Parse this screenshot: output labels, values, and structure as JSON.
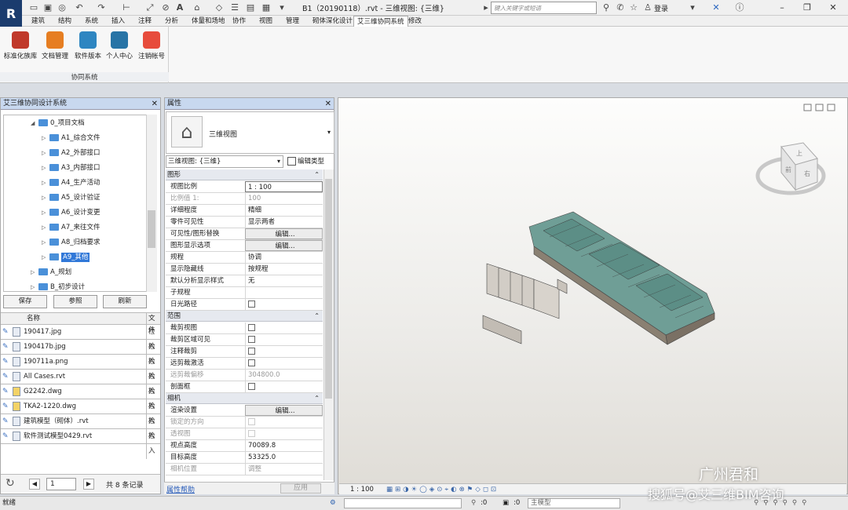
{
  "title_bar": {
    "title": "B1（20190118）.rvt - 三维视图: {三维}",
    "search_placeholder": "键入关键字或短语",
    "login_label": "登录"
  },
  "menu_tabs": [
    "建筑",
    "结构",
    "系统",
    "插入",
    "注释",
    "分析",
    "体量和场地",
    "协作",
    "视图",
    "管理",
    "砌体深化设计",
    "艾三维协同系统",
    "修改"
  ],
  "active_tab": "艾三维协同系统",
  "ribbon": {
    "buttons": [
      {
        "label": "标准化族库",
        "icon": "family-library-icon",
        "color": "#c0392b"
      },
      {
        "label": "文档管理",
        "icon": "document-manager-icon",
        "color": "#e67e22"
      },
      {
        "label": "软件版本",
        "icon": "software-version-icon",
        "color": "#2e86c1"
      },
      {
        "label": "个人中心",
        "icon": "user-icon",
        "color": "#2874a6"
      },
      {
        "label": "注销帐号",
        "icon": "power-icon",
        "color": "#e74c3c"
      }
    ],
    "group_label": "协同系统"
  },
  "left_panel": {
    "title": "艾三维协同设计系统",
    "tree": [
      {
        "label": "0_项目文档",
        "level": 0,
        "expanded": true
      },
      {
        "label": "A1_综合文件",
        "level": 1
      },
      {
        "label": "A2_外部接口",
        "level": 1
      },
      {
        "label": "A3_内部接口",
        "level": 1
      },
      {
        "label": "A4_生产活动",
        "level": 1
      },
      {
        "label": "A5_设计验证",
        "level": 1
      },
      {
        "label": "A6_设计变更",
        "level": 1
      },
      {
        "label": "A7_来往文件",
        "level": 1
      },
      {
        "label": "A8_归档要求",
        "level": 1
      },
      {
        "label": "A9_其他",
        "level": 1,
        "selected": true
      },
      {
        "label": "A_规划",
        "level": 0
      },
      {
        "label": "B_初步设计",
        "level": 0
      }
    ],
    "buttons": {
      "save": "保存",
      "reference": "参照",
      "refresh": "刷新"
    },
    "table_headers": {
      "name": "名称",
      "file": "文件"
    },
    "files": [
      {
        "name": "190417.jpg",
        "status": "检入",
        "type": "doc"
      },
      {
        "name": "190417b.jpg",
        "status": "检入",
        "type": "doc"
      },
      {
        "name": "190711a.png",
        "status": "检入",
        "type": "doc"
      },
      {
        "name": "All Cases.rvt",
        "status": "检入",
        "type": "doc"
      },
      {
        "name": "G2242.dwg",
        "status": "检入",
        "type": "dwg"
      },
      {
        "name": "TKA2-1220.dwg",
        "status": "检入",
        "type": "dwg"
      },
      {
        "name": "建筑模型（砌体）.rvt",
        "status": "检入",
        "type": "doc"
      },
      {
        "name": "软件测试模型0429.rvt",
        "status": "检入",
        "type": "doc"
      }
    ],
    "pager": {
      "page": "1",
      "total": "共 8 条记录"
    }
  },
  "properties": {
    "title": "属性",
    "type_name": "三维视图",
    "view_select": "三维视图: {三维}",
    "edit_type": "编辑类型",
    "groups": {
      "graphics": "图形",
      "extents": "范围",
      "camera": "相机"
    },
    "graphics_rows": [
      {
        "k": "视图比例",
        "v": "1 : 100",
        "style": "boxed"
      },
      {
        "k": "比例值 1:",
        "v": "100",
        "style": "dim"
      },
      {
        "k": "详细程度",
        "v": "精细"
      },
      {
        "k": "零件可见性",
        "v": "显示两者"
      },
      {
        "k": "可见性/图形替换",
        "v": "编辑...",
        "style": "btn"
      },
      {
        "k": "图形显示选项",
        "v": "编辑...",
        "style": "btn"
      },
      {
        "k": "规程",
        "v": "协调"
      },
      {
        "k": "显示隐藏线",
        "v": "按规程"
      },
      {
        "k": "默认分析显示样式",
        "v": "无"
      },
      {
        "k": "子规程",
        "v": ""
      },
      {
        "k": "日光路径",
        "v": "",
        "style": "check"
      }
    ],
    "extents_rows": [
      {
        "k": "裁剪视图",
        "v": "",
        "style": "check"
      },
      {
        "k": "裁剪区域可见",
        "v": "",
        "style": "check"
      },
      {
        "k": "注释裁剪",
        "v": "",
        "style": "check"
      },
      {
        "k": "远剪裁激活",
        "v": "",
        "style": "check"
      },
      {
        "k": "远剪裁偏移",
        "v": "304800.0",
        "style": "dim"
      },
      {
        "k": "剖面框",
        "v": "",
        "style": "check"
      }
    ],
    "camera_rows": [
      {
        "k": "渲染设置",
        "v": "编辑...",
        "style": "btn"
      },
      {
        "k": "锁定的方向",
        "v": "",
        "style": "dimcheck"
      },
      {
        "k": "透视图",
        "v": "",
        "style": "dimcheck"
      },
      {
        "k": "视点高度",
        "v": "70089.8"
      },
      {
        "k": "目标高度",
        "v": "53325.0"
      },
      {
        "k": "相机位置",
        "v": "调整",
        "style": "dim"
      }
    ],
    "help_link": "属性帮助",
    "apply": "应用"
  },
  "viewport": {
    "scale": "1 : 100",
    "viewcube": {
      "top": "上",
      "front": "前",
      "right": "右"
    }
  },
  "status_bar": {
    "text": "就绪",
    "count1": ":0",
    "count2": ":0",
    "model": "主模型"
  },
  "watermark": {
    "line1": "广州君和",
    "line2": "搜狐号@艾三维BIM咨询"
  }
}
